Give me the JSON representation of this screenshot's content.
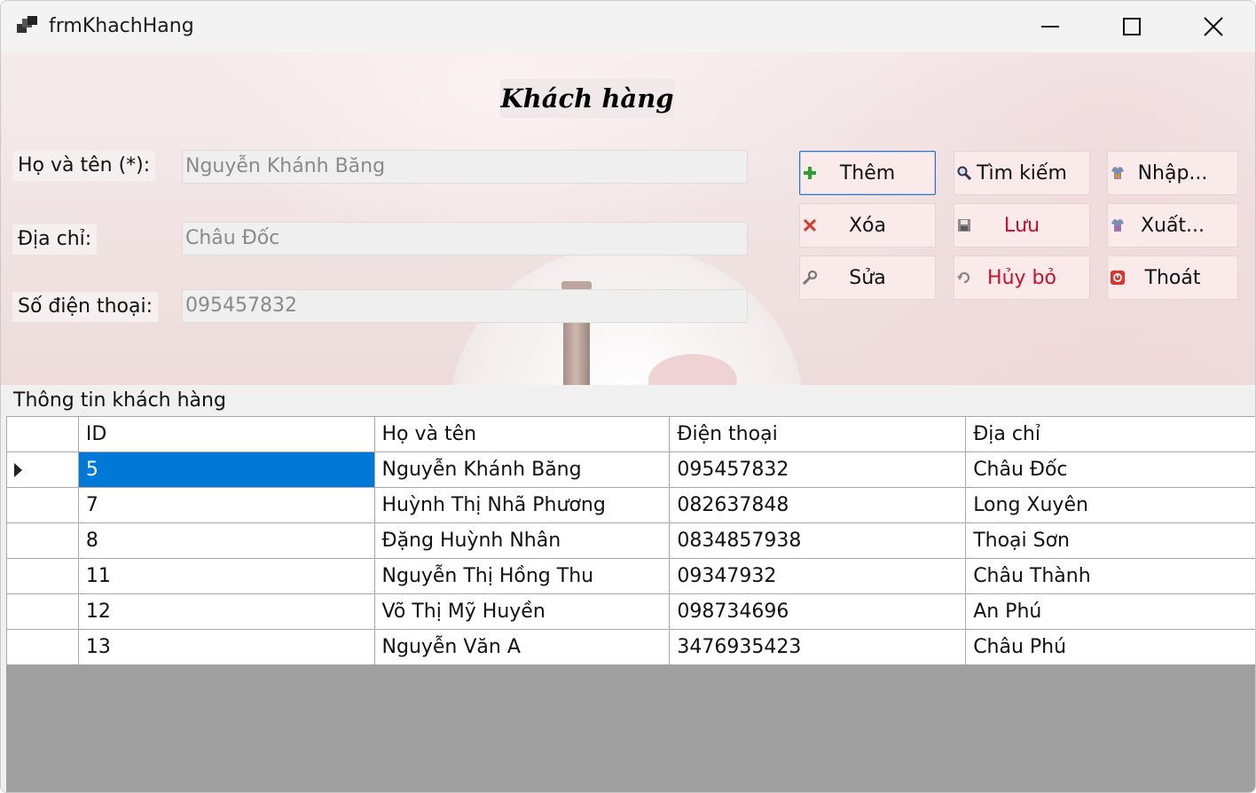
{
  "window": {
    "title": "frmKhachHang"
  },
  "form": {
    "heading": "Khách hàng",
    "labels": {
      "name": "Họ và tên (*):",
      "address": "Địa chỉ:",
      "phone": "Số điện thoại:"
    },
    "values": {
      "name": "Nguyễn Khánh Băng",
      "address": "Châu Đốc",
      "phone": "095457832"
    }
  },
  "buttons": {
    "add": "Thêm",
    "search": "Tìm kiếm",
    "import": "Nhập...",
    "delete": "Xóa",
    "save": "Lưu",
    "export": "Xuất...",
    "edit": "Sửa",
    "cancel": "Hủy bỏ",
    "exit": "Thoát"
  },
  "group": {
    "title": "Thông tin khách hàng"
  },
  "table": {
    "columns": [
      "ID",
      "Họ và tên",
      "Điện thoại",
      "Địa chỉ"
    ],
    "rows": [
      [
        "5",
        "Nguyễn Khánh Băng",
        "095457832",
        "Châu Đốc"
      ],
      [
        "7",
        "Huỳnh Thị Nhã Phương",
        "082637848",
        "Long Xuyên"
      ],
      [
        "8",
        "Đặng Huỳnh Nhân",
        "0834857938",
        "Thoại Sơn"
      ],
      [
        "11",
        "Nguyễn Thị Hồng Thu",
        "09347932",
        "Châu Thành"
      ],
      [
        "12",
        "Võ Thị Mỹ Huyền",
        "098734696",
        "An Phú"
      ],
      [
        "13",
        "Nguyễn Văn A",
        "3476935423",
        "Châu Phú"
      ]
    ]
  },
  "colors": {
    "accent": "#0078d7",
    "button_bg": "#fbeaea",
    "danger_text": "#c8102e",
    "grid_empty": "#a0a0a0"
  }
}
